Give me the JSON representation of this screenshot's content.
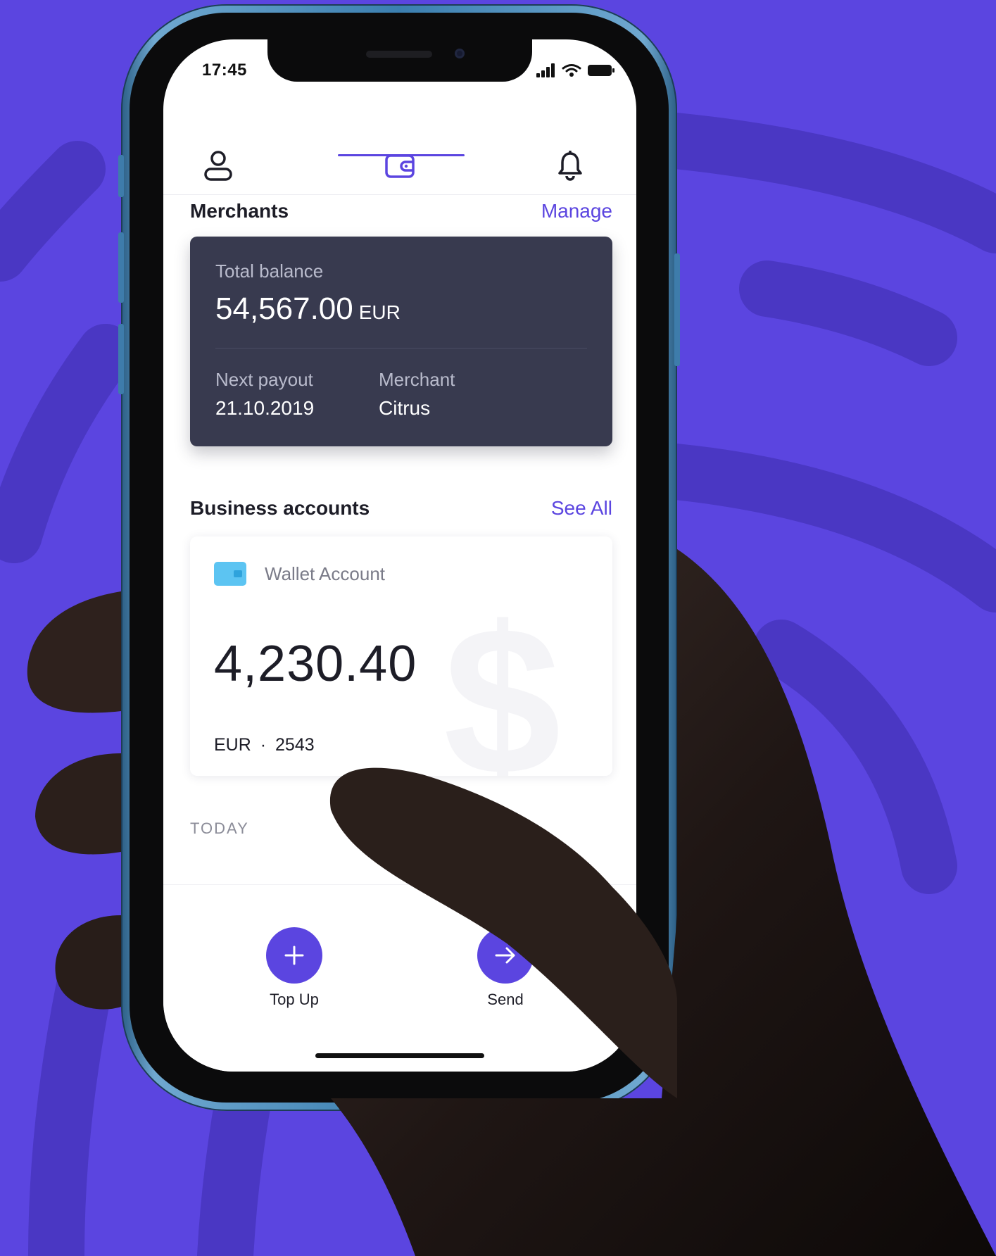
{
  "status_bar": {
    "time": "17:45"
  },
  "tabs": [
    {
      "name": "profile",
      "icon": "user-icon"
    },
    {
      "name": "wallet",
      "icon": "wallet-icon",
      "active": true
    },
    {
      "name": "notifications",
      "icon": "bell-icon"
    }
  ],
  "merchants": {
    "title": "Merchants",
    "manage_label": "Manage",
    "card": {
      "total_label": "Total balance",
      "total_amount": "54,567.00",
      "total_currency": "EUR",
      "payout_label": "Next payout",
      "payout_date": "21.10.2019",
      "merchant_label": "Merchant",
      "merchant_name": "Citrus"
    }
  },
  "business_accounts": {
    "title": "Business accounts",
    "see_all_label": "See All",
    "wallet": {
      "name": "Wallet Account",
      "amount": "4,230.40",
      "currency": "EUR",
      "separator": "·",
      "number": "2543",
      "watermark": "$"
    }
  },
  "feed": {
    "section_label": "TODAY"
  },
  "actions": {
    "top_up_label": "Top Up",
    "send_label": "Send"
  },
  "colors": {
    "accent": "#5b45e0",
    "card_dark": "#383a4f",
    "wallet_icon": "#5cc4f2",
    "phone_frame": "#3b7fb0"
  }
}
